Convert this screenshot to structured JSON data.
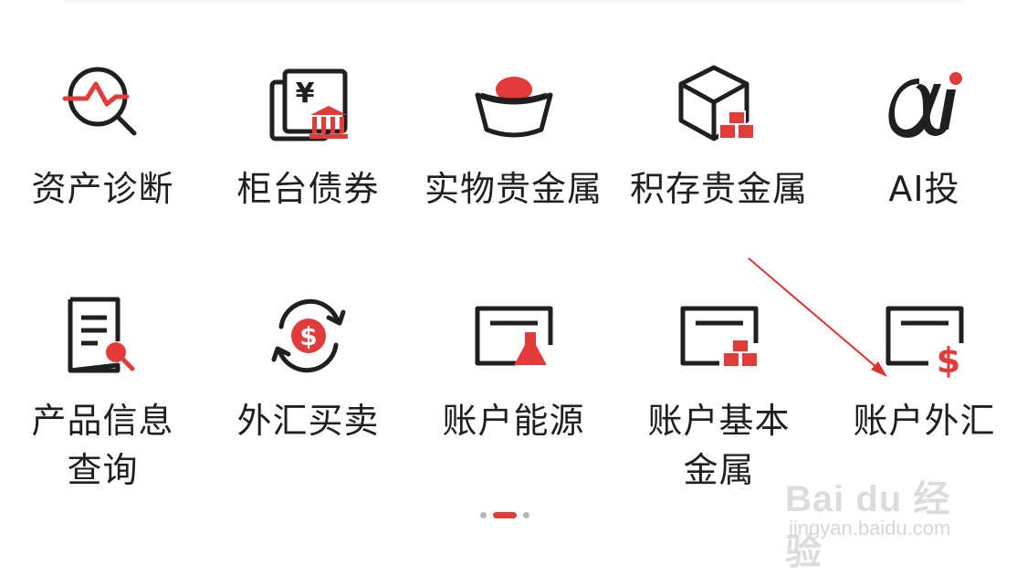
{
  "colors": {
    "accent": "#e33a3a",
    "icon_stroke": "#1f1f1f",
    "text": "#1f1f1f",
    "pager_inactive": "#b5b5b5",
    "annotation_arrow": "#e0302f"
  },
  "menu": {
    "items": [
      {
        "label": "资产诊断",
        "icon": "magnifier-pulse-icon"
      },
      {
        "label": "柜台债券",
        "icon": "bond-certificate-icon"
      },
      {
        "label": "实物贵金属",
        "icon": "gold-ingot-bowl-icon"
      },
      {
        "label": "积存贵金属",
        "icon": "cube-gold-bars-icon"
      },
      {
        "label": "AI投",
        "icon": "ai-logo-icon"
      },
      {
        "label": "产品信息查询",
        "label_line1": "产品信息",
        "label_line2": "查询",
        "icon": "document-search-icon"
      },
      {
        "label": "外汇买卖",
        "icon": "currency-exchange-icon"
      },
      {
        "label": "账户能源",
        "icon": "card-flask-icon"
      },
      {
        "label": "账户基本金属",
        "label_line1": "账户基本",
        "label_line2": "金属",
        "icon": "card-metal-bars-icon"
      },
      {
        "label": "账户外汇",
        "icon": "card-dollar-icon"
      }
    ]
  },
  "pager": {
    "total_pages": 3,
    "current_page": 2
  },
  "watermark": {
    "logo_text": "Bai du 经验",
    "url_text": "jingyan.baidu.com"
  }
}
